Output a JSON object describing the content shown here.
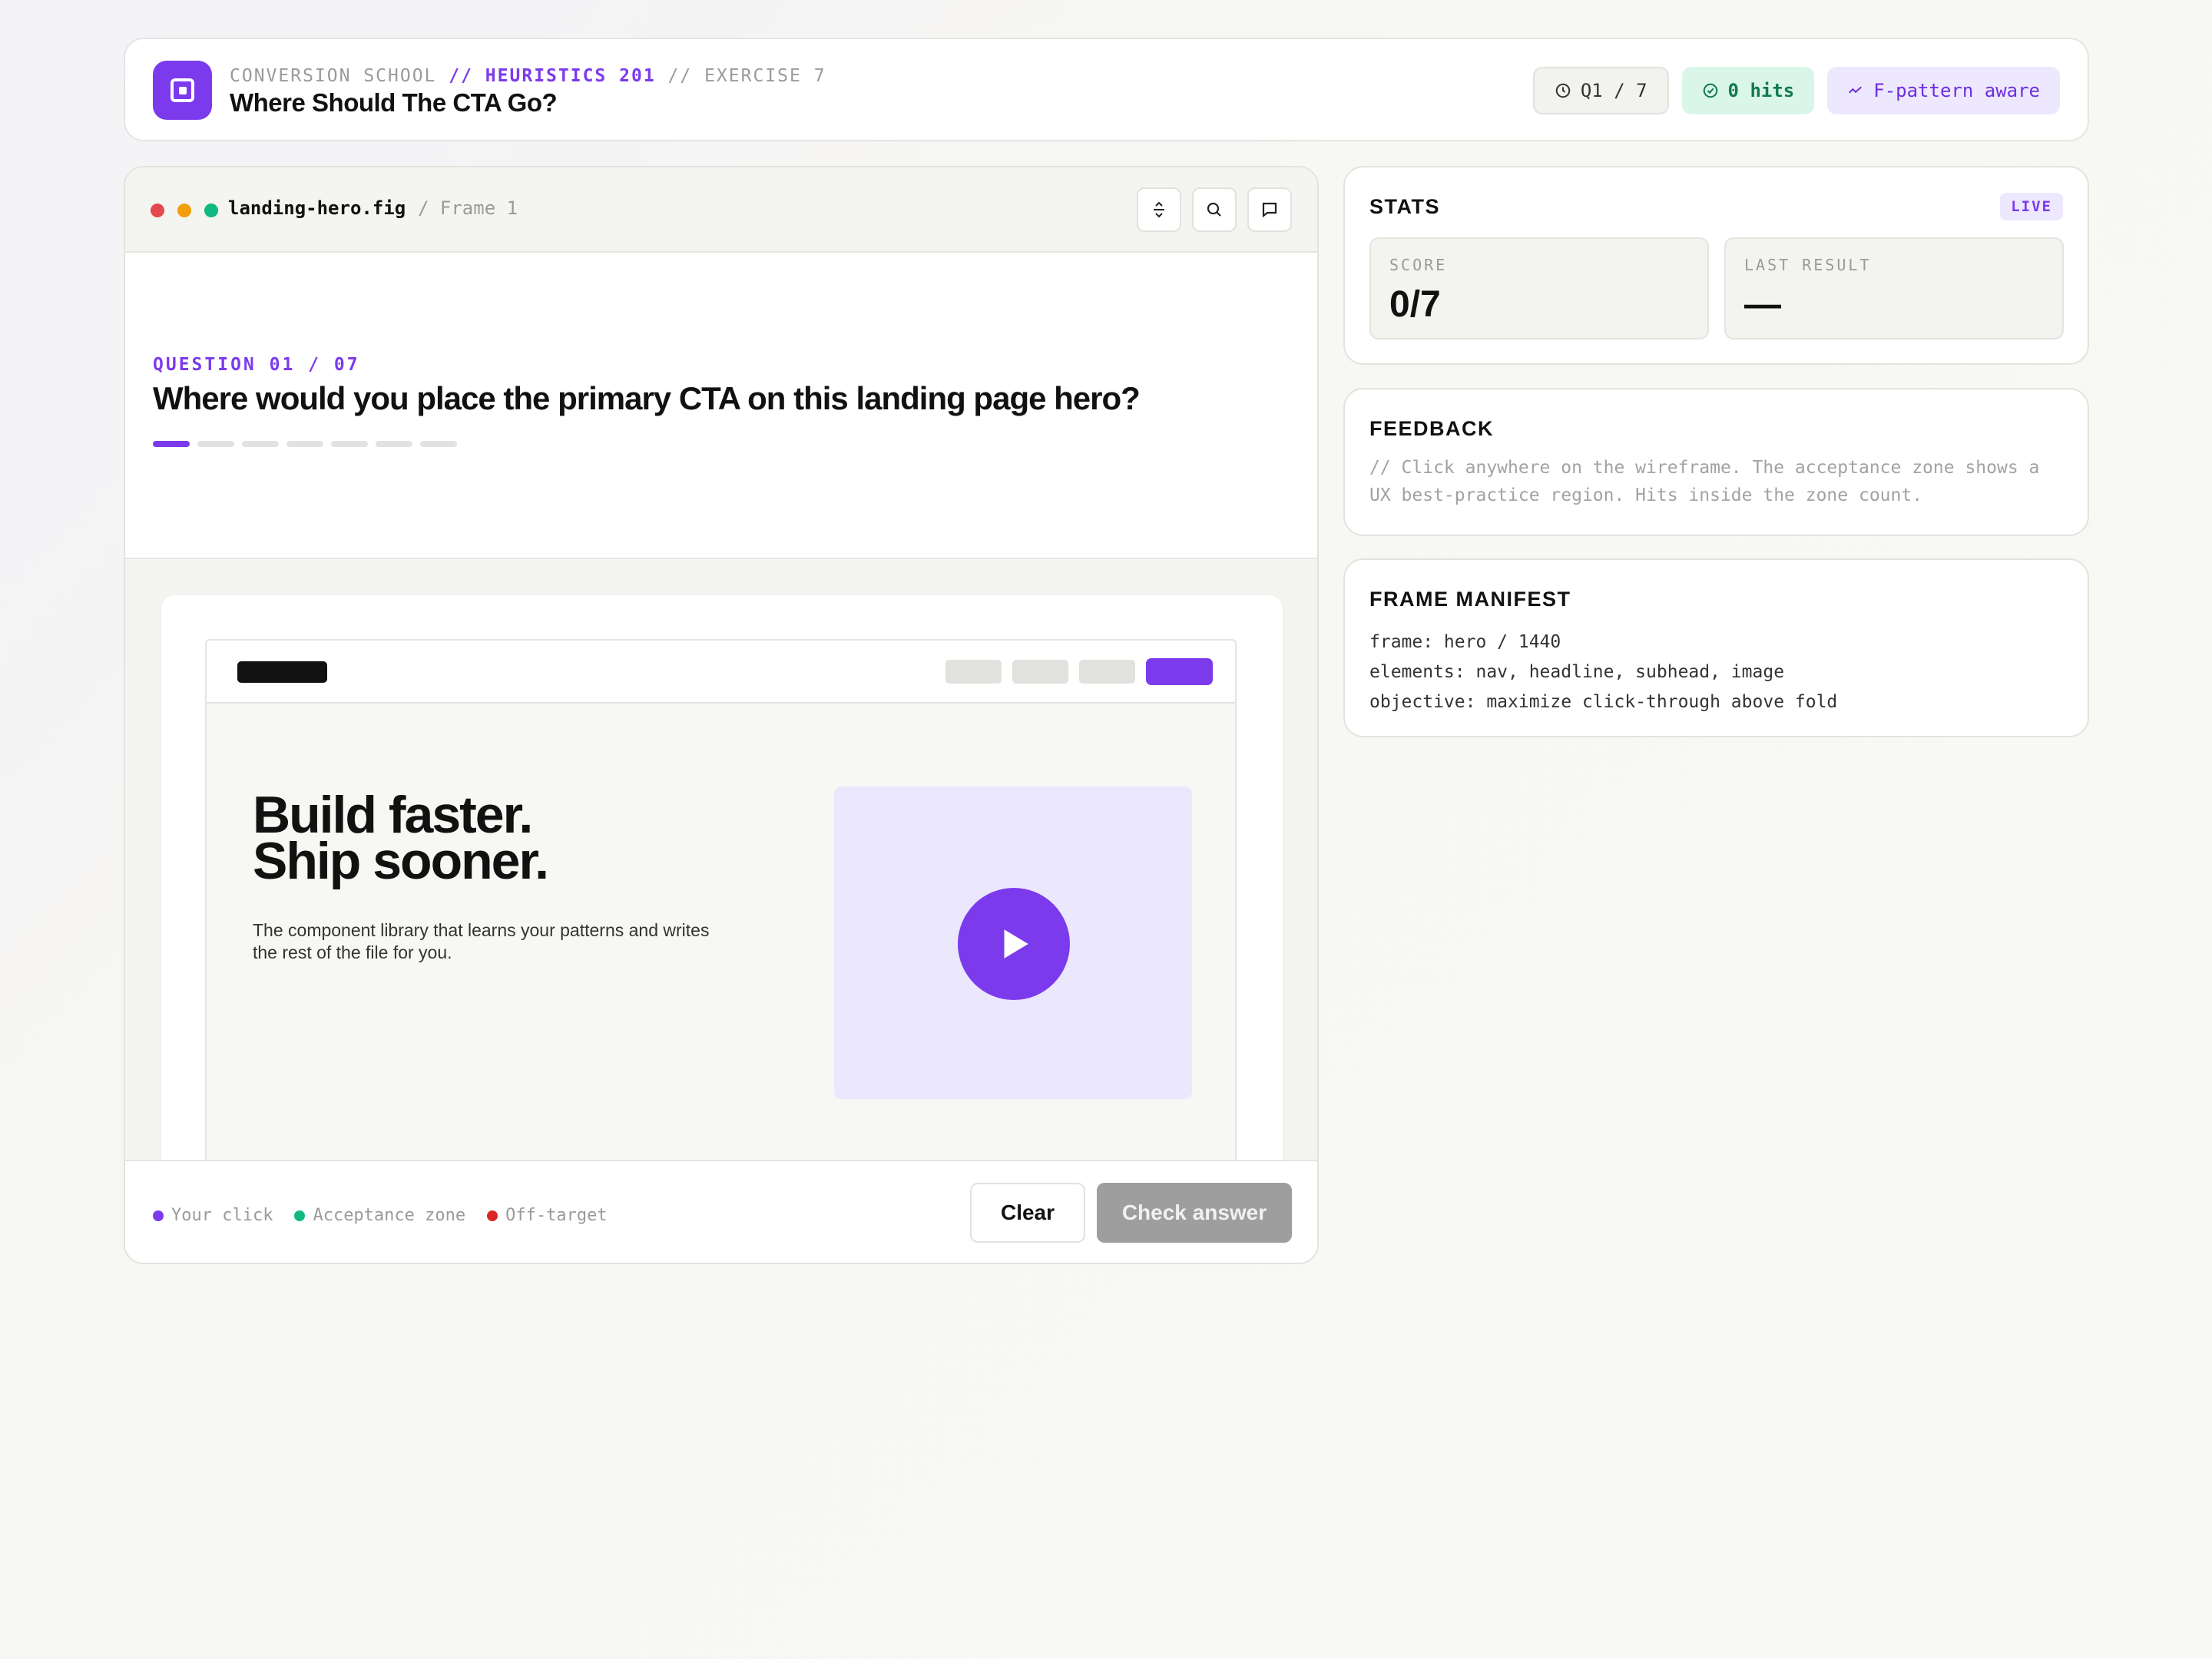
{
  "header": {
    "crumb_prefix": "CONVERSION SCHOOL",
    "crumb_course": "// HEURISTICS 201",
    "crumb_exercise": "// EXERCISE 7",
    "title": "Where Should The CTA Go?",
    "chip_question": "Q1 / 7",
    "chip_hits": "0 hits",
    "chip_pattern": "F-pattern aware"
  },
  "canvas": {
    "file_name": "landing-hero.fig",
    "frame_name": "/ Frame 1",
    "window_dot_colors": [
      "#e5484d",
      "#f59e0b",
      "#10b981"
    ],
    "question_label": "QUESTION 01 / 07",
    "question_text": "Where would you place the primary CTA on this landing page hero?",
    "progress_total": 7,
    "progress_current": 1
  },
  "wireframe": {
    "headline_line1": "Build faster.",
    "headline_line2": "Ship sooner.",
    "subhead": "The component library that learns your patterns and writes the rest of the file for you.",
    "media_icon": "play-icon"
  },
  "legend": {
    "your_click": "Your click",
    "acceptance_zone": "Acceptance zone",
    "off_target": "Off-target",
    "colors": {
      "your_click": "#7c3aed",
      "acceptance_zone": "#10b981",
      "off_target": "#dc2626"
    }
  },
  "actions": {
    "clear_label": "Clear",
    "check_label": "Check answer"
  },
  "stats": {
    "title": "STATS",
    "badge": "LIVE",
    "score_label": "SCORE",
    "score_value": "0/7",
    "last_result_label": "LAST RESULT",
    "last_result_value": "—"
  },
  "feedback": {
    "title": "FEEDBACK",
    "text": "// Click anywhere on the wireframe. The acceptance zone shows a UX best-practice region. Hits inside the zone count."
  },
  "manifest": {
    "title": "FRAME MANIFEST",
    "lines": [
      "frame: hero / 1440",
      "elements: nav, headline, subhead, image",
      "objective: maximize click-through above fold"
    ]
  },
  "colors": {
    "accent": "#7c3aed",
    "success": "#127a4f",
    "check_disabled": "#9e9e9e"
  }
}
